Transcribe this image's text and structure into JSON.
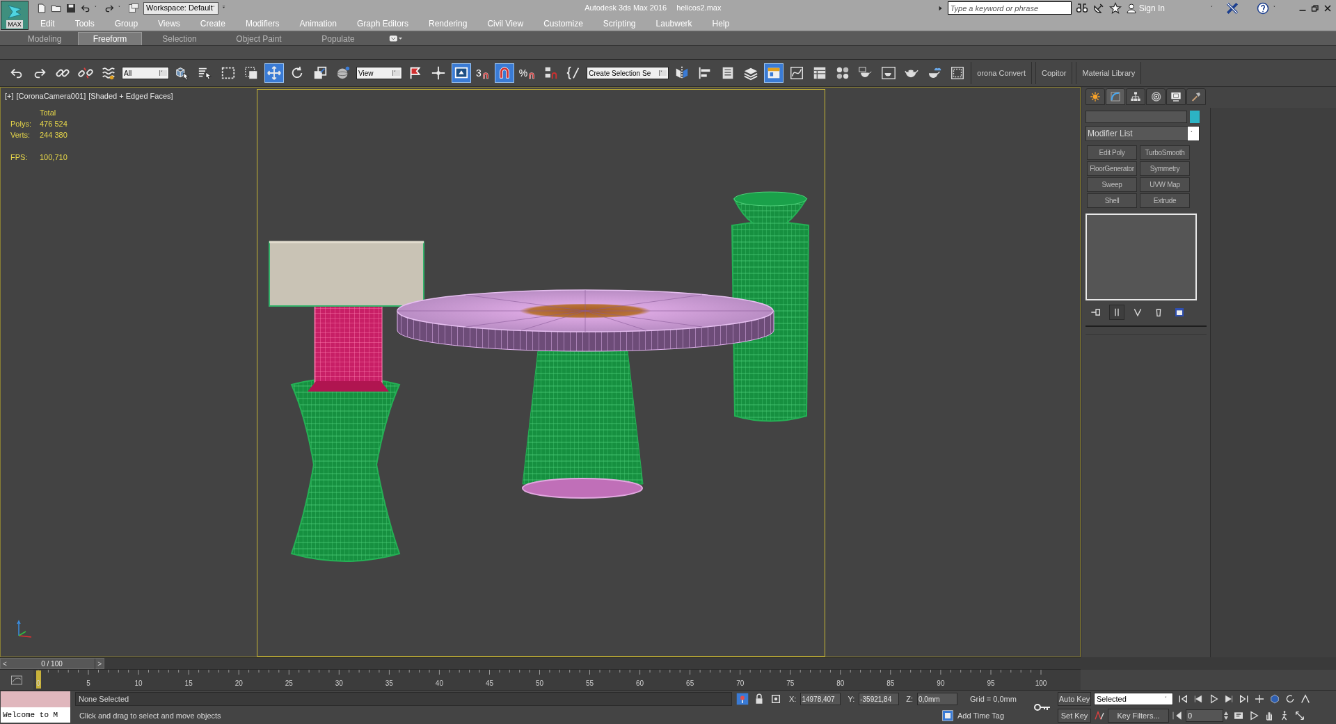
{
  "title_bar": {
    "logo": "MAX",
    "workspace": "Workspace: Default",
    "app_title": "Autodesk 3ds Max 2016",
    "file_name": "helicos2.max",
    "search": {
      "placeholder": "Type a keyword or phrase"
    },
    "sign_in": "Sign In"
  },
  "menu": [
    "Edit",
    "Tools",
    "Group",
    "Views",
    "Create",
    "Modifiers",
    "Animation",
    "Graph Editors",
    "Rendering",
    "Civil View",
    "Customize",
    "Scripting",
    "Laubwerk",
    "Help"
  ],
  "ribbon_tabs": [
    {
      "label": "Modeling",
      "selected": false
    },
    {
      "label": "Freeform",
      "selected": true
    },
    {
      "label": "Selection",
      "selected": false
    },
    {
      "label": "Object Paint",
      "selected": false
    },
    {
      "label": "Populate",
      "selected": false
    }
  ],
  "toolbar": [
    {
      "kind": "icon",
      "selected": false
    },
    {
      "kind": "icon",
      "selected": false
    },
    {
      "kind": "icon",
      "selected": false
    },
    {
      "kind": "icon",
      "selected": false
    },
    {
      "kind": "icon",
      "selected": false
    },
    {
      "kind": "dropdown",
      "value": "All"
    },
    {
      "kind": "icon",
      "selected": false
    },
    {
      "kind": "icon",
      "selected": false
    },
    {
      "kind": "icon",
      "selected": false
    },
    {
      "kind": "icon",
      "selected": false
    },
    {
      "kind": "icon",
      "selected": true
    },
    {
      "kind": "icon",
      "selected": false
    },
    {
      "kind": "icon",
      "selected": false
    },
    {
      "kind": "icon",
      "selected": false
    },
    {
      "kind": "dropdown",
      "value": "View"
    },
    {
      "kind": "icon",
      "selected": false
    },
    {
      "kind": "icon",
      "selected": false
    },
    {
      "kind": "icon",
      "selected": true
    },
    {
      "kind": "snap",
      "label": "3",
      "selected": false
    },
    {
      "kind": "icon",
      "selected": true
    },
    {
      "kind": "snap",
      "label": "%",
      "selected": false
    },
    {
      "kind": "icon",
      "selected": false
    },
    {
      "kind": "icon",
      "selected": false
    },
    {
      "kind": "dropdown",
      "value": "Create Selection Se"
    },
    {
      "kind": "icon",
      "selected": false
    },
    {
      "kind": "icon",
      "selected": false
    },
    {
      "kind": "icon",
      "selected": false
    },
    {
      "kind": "icon",
      "selected": false
    },
    {
      "kind": "icon",
      "selected": true
    },
    {
      "kind": "icon",
      "selected": false
    },
    {
      "kind": "icon",
      "selected": false
    },
    {
      "kind": "icon",
      "selected": false
    },
    {
      "kind": "icon",
      "selected": false
    },
    {
      "kind": "icon",
      "selected": false
    },
    {
      "kind": "icon",
      "selected": false
    },
    {
      "kind": "icon",
      "selected": false
    },
    {
      "kind": "icon",
      "selected": false
    },
    {
      "kind": "text",
      "label": "orona Convert"
    },
    {
      "kind": "text",
      "label": "Copitor"
    },
    {
      "kind": "text",
      "label": "Material Library"
    }
  ],
  "viewport": {
    "menus": [
      "[+]",
      "[CoronaCamera001]",
      "[Shaded + Edged Faces]"
    ],
    "stats_header": "Total",
    "stats": [
      {
        "label": "Polys:",
        "value": "476 524"
      },
      {
        "label": "Verts:",
        "value": "244 380"
      }
    ],
    "fps": {
      "label": "FPS:",
      "value": "100,710"
    }
  },
  "command_panel": {
    "tabs": [
      {
        "selected": false
      },
      {
        "selected": true
      },
      {
        "selected": false
      },
      {
        "selected": false
      },
      {
        "selected": false
      },
      {
        "selected": false
      }
    ],
    "modifier_list": "Modifier List",
    "modifier_buttons": [
      "Edit Poly",
      "TurboSmooth",
      "FloorGenerator",
      "Symmetry",
      "Sweep",
      "UVW Map",
      "Shell",
      "Extrude"
    ],
    "stack_tools": [
      {
        "selected": false
      },
      {
        "selected": true
      },
      {
        "selected": false
      },
      {
        "selected": false
      },
      {
        "selected": false
      }
    ]
  },
  "timeline": {
    "prev": "<",
    "frame_label": "0 / 100",
    "next": ">",
    "level": 0,
    "ticks": [
      "0",
      "5",
      "10",
      "15",
      "20",
      "25",
      "30",
      "35",
      "40",
      "45",
      "50",
      "55",
      "60",
      "65",
      "70",
      "75",
      "80",
      "85",
      "90",
      "95",
      "100"
    ]
  },
  "status": {
    "listener": "Welcome to M",
    "selection": "None Selected",
    "prompt": "Click and drag to select and move objects",
    "coords": [
      {
        "axis": "X:",
        "value": "14978,407"
      },
      {
        "axis": "Y:",
        "value": "-35921,84"
      },
      {
        "axis": "Z:",
        "value": "0,0mm"
      }
    ],
    "grid": "Grid = 0,0mm",
    "add_time_tag": "Add Time Tag"
  },
  "animation": {
    "auto_key": "Auto Key",
    "key_mode": "Selected",
    "set_key": "Set Key",
    "key_filters": "Key Filters...",
    "current_frame": "0"
  }
}
